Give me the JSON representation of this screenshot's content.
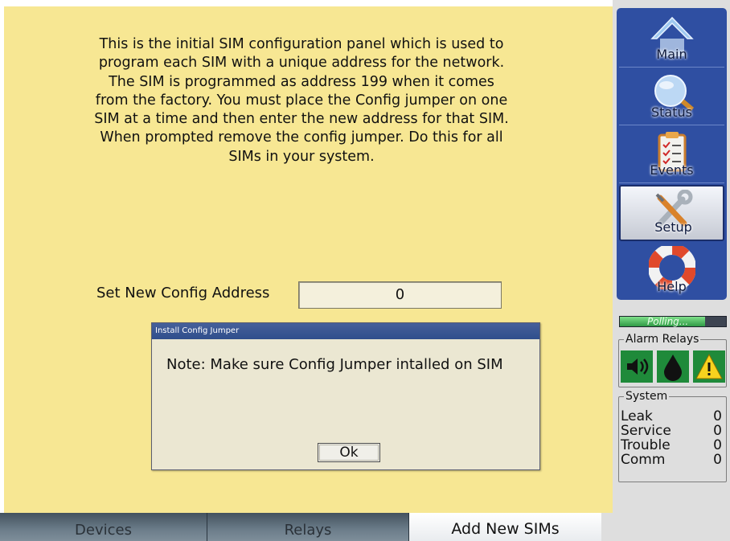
{
  "main": {
    "intro_text": "This is the initial SIM configuration panel which is used to program each SIM with a unique address for the network. The SIM is programmed as address 199 when it comes from the factory. You must place the Config jumper on one SIM at a time and then enter the new address for that SIM. When prompted remove the config jumper. Do this for all SIMs in your system.",
    "config_label": "Set New Config Address",
    "config_value": "0"
  },
  "dialog": {
    "title": "Install Config Jumper",
    "message": "Note: Make sure Config Jumper intalled on SIM",
    "ok_label": "Ok"
  },
  "tabs": [
    {
      "label": "Devices",
      "active": false
    },
    {
      "label": "Relays",
      "active": false
    },
    {
      "label": "Add New SIMs",
      "active": true
    }
  ],
  "nav": {
    "items": [
      {
        "label": "Main",
        "icon": "home-icon",
        "active": false
      },
      {
        "label": "Status",
        "icon": "magnifier-icon",
        "active": false
      },
      {
        "label": "Events",
        "icon": "clipboard-icon",
        "active": false
      },
      {
        "label": "Setup",
        "icon": "wrench-screwdriver-icon",
        "active": true
      },
      {
        "label": "Help",
        "icon": "lifebuoy-icon",
        "active": false
      }
    ]
  },
  "status": {
    "polling_text": "Polling...",
    "polling_progress": 0.8,
    "alarm_relays_title": "Alarm Relays",
    "alarm_icons": [
      "speaker-icon",
      "water-drop-icon",
      "warning-icon"
    ],
    "system_title": "System",
    "system_rows": [
      {
        "label": "Leak",
        "count": "0"
      },
      {
        "label": "Service",
        "count": "0"
      },
      {
        "label": "Trouble",
        "count": "0"
      },
      {
        "label": "Comm",
        "count": "0"
      }
    ]
  },
  "colors": {
    "panel_background": "#f7e793",
    "nav_background": "#2f4fa2",
    "dialog_titlebar": "#2f4e8c"
  }
}
